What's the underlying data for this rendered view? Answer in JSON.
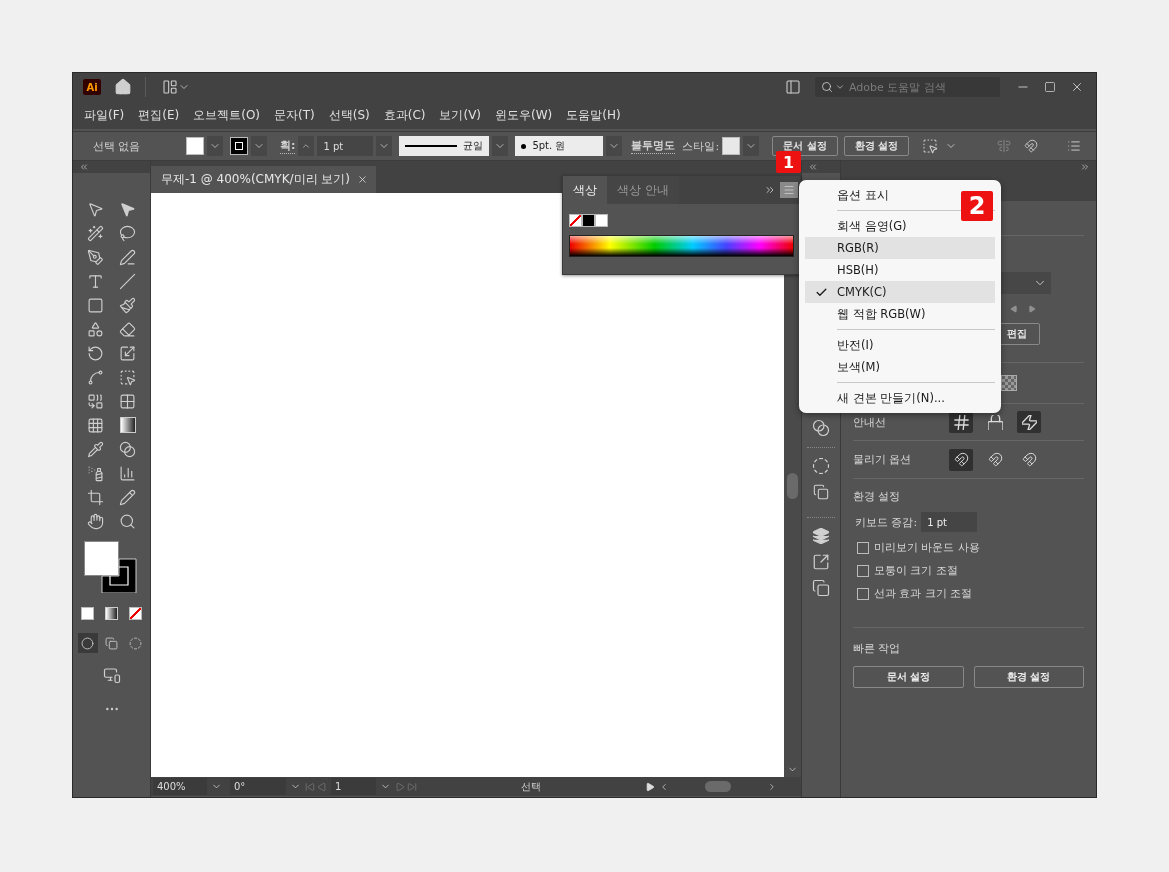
{
  "title_bar": {
    "app_logo": "Ai",
    "search": {
      "placeholder": "Adobe 도움말 검색"
    }
  },
  "menu_bar": [
    "파일(F)",
    "편집(E)",
    "오브젝트(O)",
    "문자(T)",
    "선택(S)",
    "효과(C)",
    "보기(V)",
    "윈도우(W)",
    "도움말(H)"
  ],
  "control_bar": {
    "selection": "선택 없음",
    "stroke_label": "획:",
    "stroke_weight": "1 pt",
    "stroke_profile": "균일",
    "brush": "5pt. 원",
    "opacity_label": "불투명도",
    "style_label": "스타일:",
    "buttons": [
      "문서 설정",
      "환경 설정"
    ]
  },
  "toolbar": {
    "draw_modes": [
      {
        "selected": true
      },
      {
        "selected": false
      },
      {
        "selected": false
      }
    ]
  },
  "document": {
    "tab": "무제-1 @ 400%(CMYK/미리 보기)",
    "status_bar": {
      "zoom": "400%",
      "rotation": "0°",
      "artboard": "1",
      "tool": "선택"
    }
  },
  "color_panel": {
    "tabs": [
      {
        "label": "색상",
        "selected": true
      },
      {
        "label": "색상 안내",
        "selected": false
      }
    ]
  },
  "panel_menu": {
    "items": [
      {
        "kind": "item",
        "label": "옵션 표시",
        "checked": false,
        "highlighted": false
      },
      {
        "kind": "separator"
      },
      {
        "kind": "item",
        "label": "회색 음영(G)",
        "checked": false,
        "highlighted": false
      },
      {
        "kind": "item",
        "label": "RGB(R)",
        "checked": false,
        "highlighted": true
      },
      {
        "kind": "item",
        "label": "HSB(H)",
        "checked": false,
        "highlighted": false
      },
      {
        "kind": "item",
        "label": "CMYK(C)",
        "checked": true,
        "highlighted": true
      },
      {
        "kind": "item",
        "label": "웹 적합 RGB(W)",
        "checked": false,
        "highlighted": false
      },
      {
        "kind": "separator"
      },
      {
        "kind": "item",
        "label": "반전(I)",
        "checked": false,
        "highlighted": false
      },
      {
        "kind": "item",
        "label": "보색(M)",
        "checked": false,
        "highlighted": false
      },
      {
        "kind": "separator"
      },
      {
        "kind": "item",
        "label": "새 견본 만들기(N)...",
        "checked": false,
        "highlighted": false
      }
    ]
  },
  "callouts": [
    "1",
    "2"
  ],
  "properties_panel": {
    "edit_button": "편집",
    "guides": {
      "label": "안내선",
      "buttons": [
        {
          "on": true
        },
        {
          "on": false
        },
        {
          "on": true
        }
      ]
    },
    "snap": {
      "label": "물리기 옵션",
      "buttons": [
        {
          "on": true
        },
        {
          "on": false
        },
        {
          "on": false
        }
      ]
    },
    "preferences": {
      "title": "환경 설정",
      "keyboard_label": "키보드 증감:",
      "keyboard_value": "1 pt",
      "checkboxes": [
        {
          "label": "미리보기 바운드 사용",
          "checked": false
        },
        {
          "label": "모퉁이 크기 조절",
          "checked": false
        },
        {
          "label": "선과 효과 크기 조절",
          "checked": false
        }
      ]
    },
    "quick_actions": {
      "title": "빠른 작업",
      "buttons": [
        "문서 설정",
        "환경 설정"
      ]
    }
  }
}
